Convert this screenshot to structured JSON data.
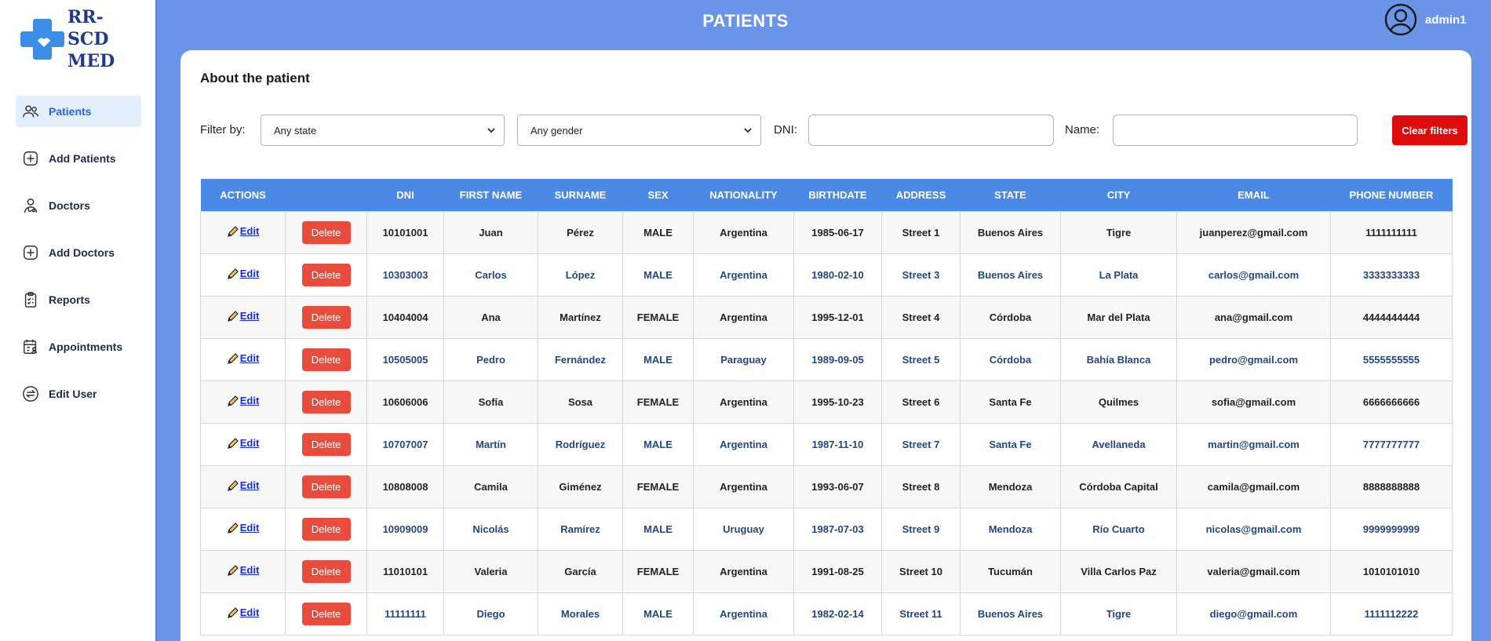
{
  "brand": {
    "line1": "RR-",
    "line2": "SCD",
    "line3": "MED",
    "color": "#1f3a8a",
    "cross_color": "#3a8ee6"
  },
  "sidebar": {
    "items": [
      {
        "label": "Patients",
        "icon": "patients-icon",
        "active": true
      },
      {
        "label": "Add Patients",
        "icon": "plus-square-icon",
        "active": false
      },
      {
        "label": "Doctors",
        "icon": "doctor-icon",
        "active": false
      },
      {
        "label": "Add Doctors",
        "icon": "plus-square-icon",
        "active": false
      },
      {
        "label": "Reports",
        "icon": "clipboard-icon",
        "active": false
      },
      {
        "label": "Appointments",
        "icon": "calendar-user-icon",
        "active": false
      },
      {
        "label": "Edit User",
        "icon": "swap-icon",
        "active": false
      }
    ]
  },
  "header": {
    "title": "PATIENTS",
    "username": "admin1",
    "avatar_icon": "user-circle-icon"
  },
  "main": {
    "section_title": "About the patient",
    "filters": {
      "label": "Filter by:",
      "state_value": "Any state",
      "gender_value": "Any gender",
      "dni_label": "DNI:",
      "dni_value": "",
      "name_label": "Name:",
      "name_value": "",
      "clear_label": "Clear filters"
    }
  },
  "table": {
    "headers": [
      "ACTIONS",
      "",
      "DNI",
      "FIRST NAME",
      "SURNAME",
      "SEX",
      "NATIONALITY",
      "BIRTHDATE",
      "ADDRESS",
      "STATE",
      "CITY",
      "EMAIL",
      "PHONE NUMBER"
    ],
    "edit_label": "Edit",
    "delete_label": "Delete",
    "rows": [
      {
        "dni": "10101001",
        "first": "Juan",
        "surname": "Pérez",
        "sex": "MALE",
        "nationality": "Argentina",
        "birthdate": "1985-06-17",
        "address": "Street 1",
        "state": "Buenos Aires",
        "city": "Tigre",
        "email": "juanperez@gmail.com",
        "phone": "1111111111"
      },
      {
        "dni": "10303003",
        "first": "Carlos",
        "surname": "López",
        "sex": "MALE",
        "nationality": "Argentina",
        "birthdate": "1980-02-10",
        "address": "Street 3",
        "state": "Buenos Aires",
        "city": "La Plata",
        "email": "carlos@gmail.com",
        "phone": "3333333333"
      },
      {
        "dni": "10404004",
        "first": "Ana",
        "surname": "Martínez",
        "sex": "FEMALE",
        "nationality": "Argentina",
        "birthdate": "1995-12-01",
        "address": "Street 4",
        "state": "Córdoba",
        "city": "Mar del Plata",
        "email": "ana@gmail.com",
        "phone": "4444444444"
      },
      {
        "dni": "10505005",
        "first": "Pedro",
        "surname": "Fernández",
        "sex": "MALE",
        "nationality": "Paraguay",
        "birthdate": "1989-09-05",
        "address": "Street 5",
        "state": "Córdoba",
        "city": "Bahía Blanca",
        "email": "pedro@gmail.com",
        "phone": "5555555555"
      },
      {
        "dni": "10606006",
        "first": "Sofía",
        "surname": "Sosa",
        "sex": "FEMALE",
        "nationality": "Argentina",
        "birthdate": "1995-10-23",
        "address": "Street 6",
        "state": "Santa Fe",
        "city": "Quilmes",
        "email": "sofia@gmail.com",
        "phone": "6666666666"
      },
      {
        "dni": "10707007",
        "first": "Martín",
        "surname": "Rodríguez",
        "sex": "MALE",
        "nationality": "Argentina",
        "birthdate": "1987-11-10",
        "address": "Street 7",
        "state": "Santa Fe",
        "city": "Avellaneda",
        "email": "martin@gmail.com",
        "phone": "7777777777"
      },
      {
        "dni": "10808008",
        "first": "Camila",
        "surname": "Giménez",
        "sex": "FEMALE",
        "nationality": "Argentina",
        "birthdate": "1993-06-07",
        "address": "Street 8",
        "state": "Mendoza",
        "city": "Córdoba Capital",
        "email": "camila@gmail.com",
        "phone": "8888888888"
      },
      {
        "dni": "10909009",
        "first": "Nicolás",
        "surname": "Ramírez",
        "sex": "MALE",
        "nationality": "Uruguay",
        "birthdate": "1987-07-03",
        "address": "Street 9",
        "state": "Mendoza",
        "city": "Río Cuarto",
        "email": "nicolas@gmail.com",
        "phone": "9999999999"
      },
      {
        "dni": "11010101",
        "first": "Valeria",
        "surname": "García",
        "sex": "FEMALE",
        "nationality": "Argentina",
        "birthdate": "1991-08-25",
        "address": "Street 10",
        "state": "Tucumán",
        "city": "Villa Carlos Paz",
        "email": "valeria@gmail.com",
        "phone": "1010101010"
      },
      {
        "dni": "11111111",
        "first": "Diego",
        "surname": "Morales",
        "sex": "MALE",
        "nationality": "Argentina",
        "birthdate": "1982-02-14",
        "address": "Street 11",
        "state": "Buenos Aires",
        "city": "Tigre",
        "email": "diego@gmail.com",
        "phone": "1111112222"
      }
    ]
  },
  "colors": {
    "page_bg": "#6a94e8",
    "table_header": "#4a8ae6",
    "delete_button": "#e74c3c",
    "clear_button": "#e00b0b",
    "active_nav_bg": "#e3effc"
  }
}
